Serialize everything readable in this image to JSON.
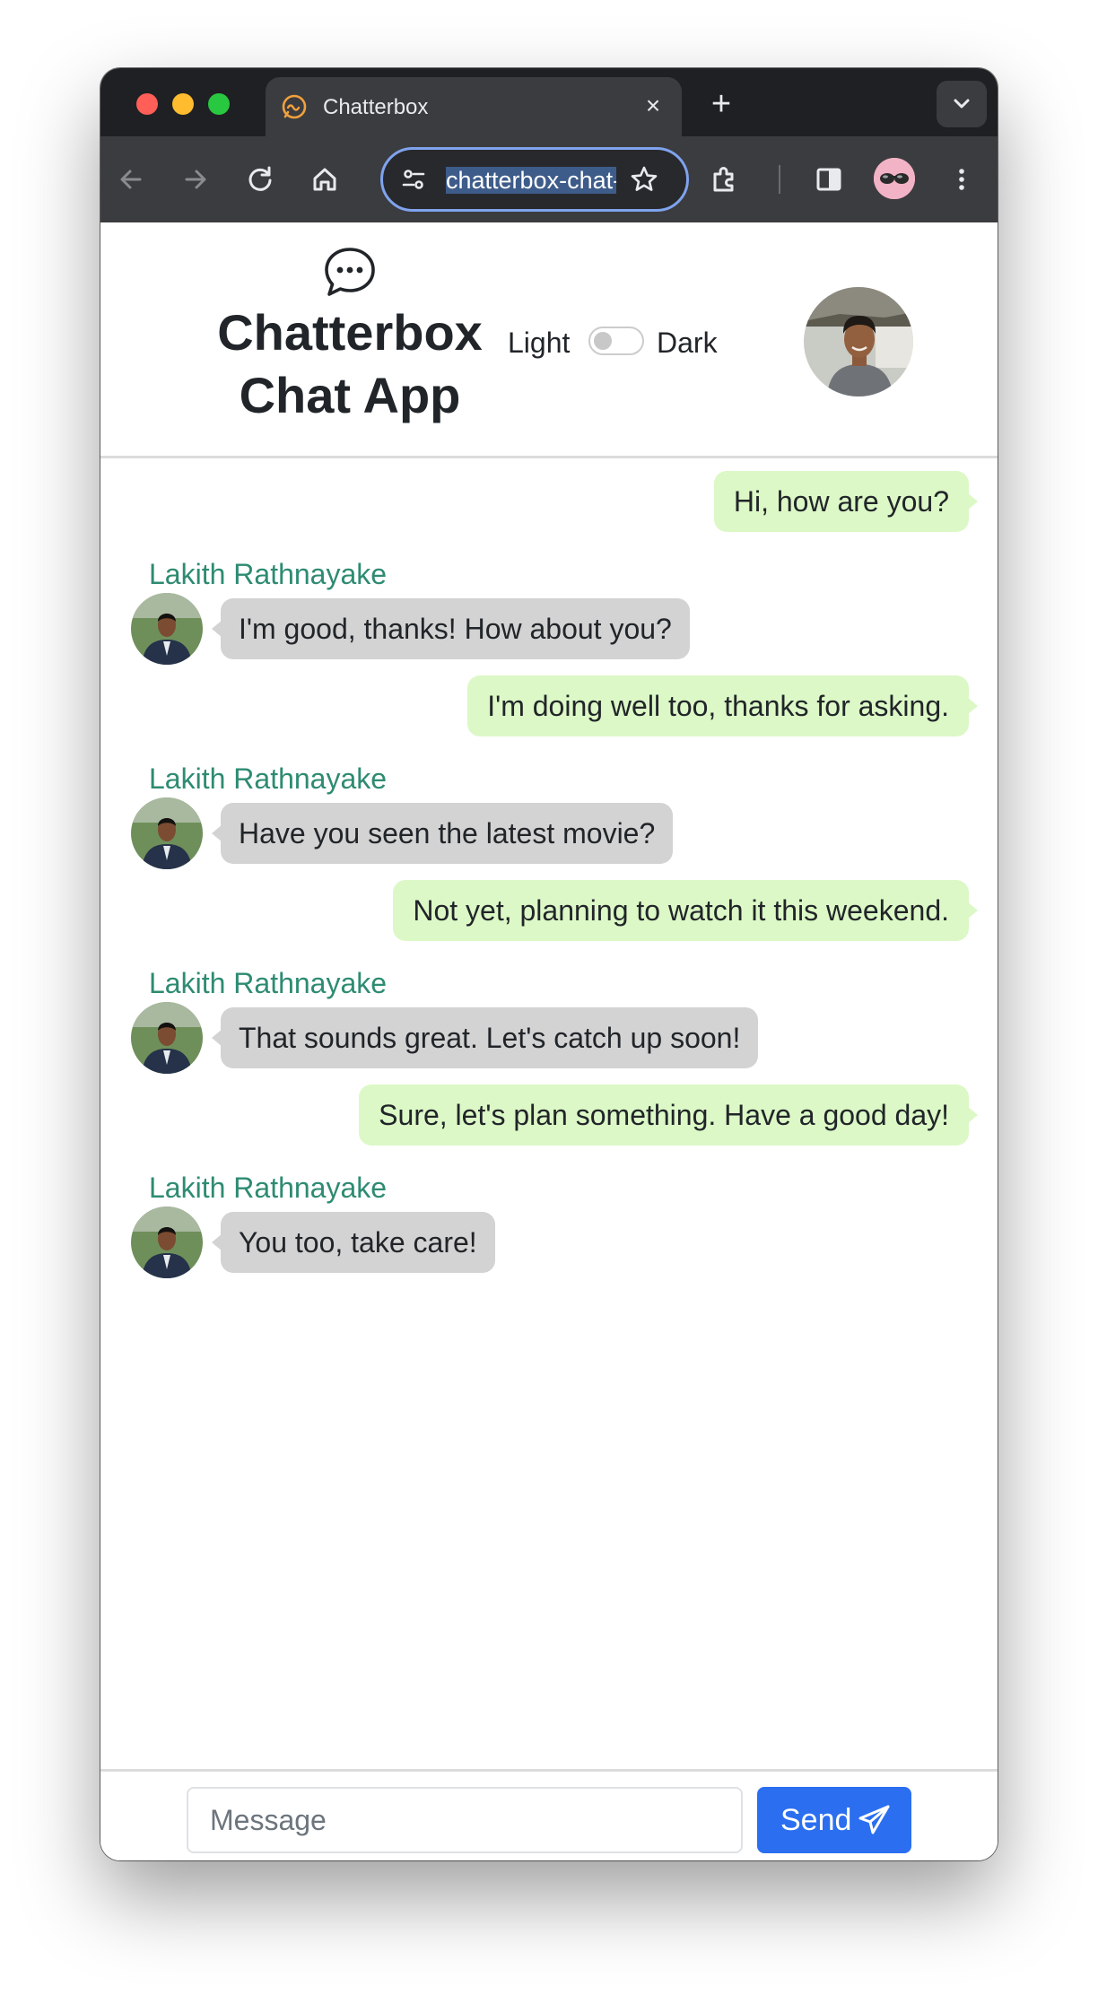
{
  "browser": {
    "tab_title": "Chatterbox",
    "address": "chatterbox-chat-app",
    "icons": {
      "back": "arrow-left-icon",
      "forward": "arrow-right-icon",
      "reload": "reload-icon",
      "home": "home-icon",
      "site_info": "tune-icon",
      "bookmark": "star-icon",
      "extensions": "puzzle-icon",
      "side_panel": "side-panel-icon",
      "menu": "kebab-menu-icon"
    }
  },
  "app": {
    "title_line1": "Chatterbox",
    "title_line2": "Chat App",
    "theme_light_label": "Light",
    "theme_dark_label": "Dark",
    "dark_mode_enabled": false
  },
  "messages": [
    {
      "direction": "out",
      "text": "Hi, how are you?"
    },
    {
      "direction": "in",
      "sender": "Lakith Rathnayake",
      "text": "I'm good, thanks! How about you?"
    },
    {
      "direction": "out",
      "text": "I'm doing well too, thanks for asking."
    },
    {
      "direction": "in",
      "sender": "Lakith Rathnayake",
      "text": "Have you seen the latest movie?"
    },
    {
      "direction": "out",
      "text": "Not yet, planning to watch it this weekend."
    },
    {
      "direction": "in",
      "sender": "Lakith Rathnayake",
      "text": "That sounds great. Let's catch up soon!"
    },
    {
      "direction": "out",
      "text": "Sure, let's plan something. Have a good day!"
    },
    {
      "direction": "in",
      "sender": "Lakith Rathnayake",
      "text": "You too, take care!"
    }
  ],
  "composer": {
    "placeholder": "Message",
    "value": "",
    "send_label": "Send"
  },
  "colors": {
    "outgoing_bubble": "#dcf8c6",
    "incoming_bubble": "#d3d3d3",
    "sender_name": "#2e8b72",
    "send_button": "#2b6ff0"
  }
}
